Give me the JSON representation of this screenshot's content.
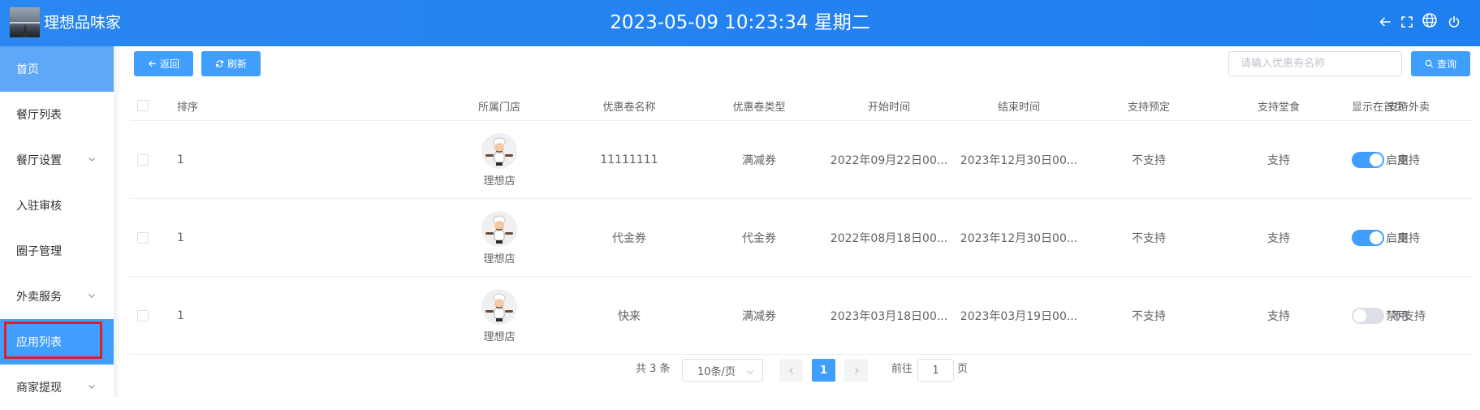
{
  "header": {
    "app_name": "理想品味家",
    "clock": "2023-05-09 10:23:34 星期二",
    "icons": [
      "back-arrow-icon",
      "fullscreen-icon",
      "globe-icon",
      "power-icon"
    ]
  },
  "sidebar": {
    "items": [
      {
        "label": "首页",
        "state": "home"
      },
      {
        "label": "餐厅列表"
      },
      {
        "label": "餐厅设置",
        "has_submenu": true
      },
      {
        "label": "入驻审核"
      },
      {
        "label": "圈子管理"
      },
      {
        "label": "外卖服务",
        "has_submenu": true
      },
      {
        "label": "应用列表",
        "state": "active"
      },
      {
        "label": "商家提现",
        "has_submenu": true
      }
    ]
  },
  "toolbar": {
    "back_label": "返回",
    "refresh_label": "刷新",
    "search_placeholder": "请输入优惠券名称",
    "search_value": "",
    "query_label": "查询"
  },
  "table": {
    "columns": [
      "排序",
      "所属门店",
      "优惠卷名称",
      "优惠卷类型",
      "开始时间",
      "结束时间",
      "支持预定",
      "支持堂食",
      "支持外卖",
      "显示在首页"
    ],
    "rows": [
      {
        "order": "1",
        "store": "理想店",
        "name": "11111111",
        "type": "满减券",
        "start": "2022年09月22日00...",
        "end": "2023年12月30日00...",
        "reserve": "不支持",
        "dine_in": "支持",
        "takeout": "支持",
        "home_on": true,
        "home_label": "启用"
      },
      {
        "order": "1",
        "store": "理想店",
        "name": "代金券",
        "type": "代金券",
        "start": "2022年08月18日00...",
        "end": "2023年12月30日00...",
        "reserve": "不支持",
        "dine_in": "支持",
        "takeout": "支持",
        "home_on": true,
        "home_label": "启用"
      },
      {
        "order": "1",
        "store": "理想店",
        "name": "快来",
        "type": "满减券",
        "start": "2023年03月18日00...",
        "end": "2023年03月19日00...",
        "reserve": "不支持",
        "dine_in": "支持",
        "takeout": "不支持",
        "home_on": false,
        "home_label": "禁用"
      }
    ]
  },
  "pagination": {
    "total_text": "共 3 条",
    "page_size": "10条/页",
    "current_page": "1",
    "goto_label": "前往",
    "goto_value": "1",
    "page_suffix": "页"
  },
  "colors": {
    "header": "#1e7ff0",
    "primary": "#409eff",
    "sidebar_home": "#5ea8f7",
    "highlight_box": "#e02020"
  }
}
